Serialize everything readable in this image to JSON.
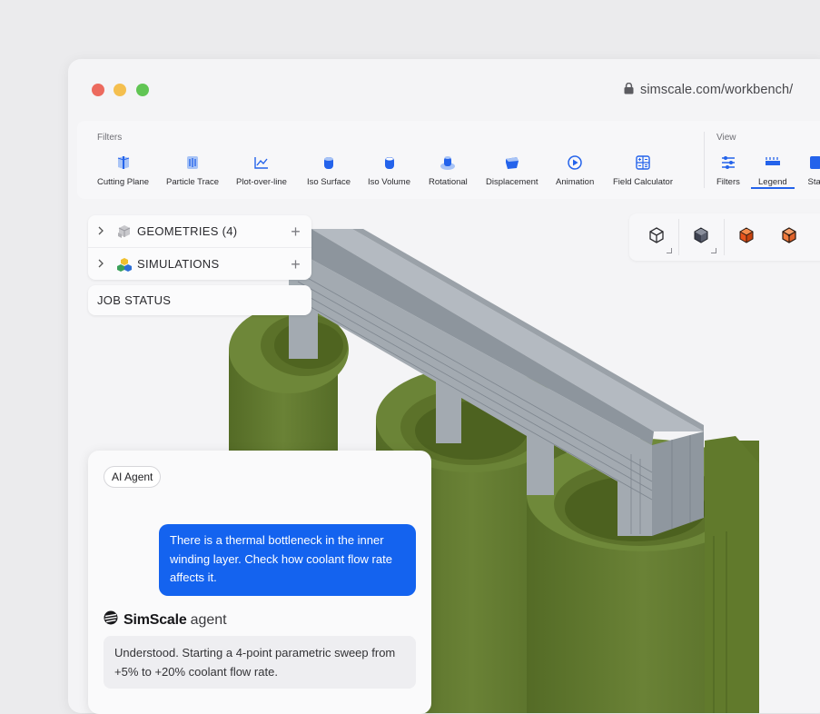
{
  "window": {
    "url": "simscale.com/workbench/"
  },
  "toolbar": {
    "filters_label": "Filters",
    "view_label": "View",
    "filters": [
      {
        "label": "Cutting Plane",
        "icon": "cutting-plane-icon"
      },
      {
        "label": "Particle Trace",
        "icon": "particle-trace-icon"
      },
      {
        "label": "Plot-over-line",
        "icon": "plot-over-line-icon"
      },
      {
        "label": "Iso Surface",
        "icon": "iso-surface-icon"
      },
      {
        "label": "Iso Volume",
        "icon": "iso-volume-icon"
      },
      {
        "label": "Rotational",
        "icon": "rotational-icon"
      },
      {
        "label": "Displacement",
        "icon": "displacement-icon"
      },
      {
        "label": "Animation",
        "icon": "animation-icon"
      },
      {
        "label": "Field Calculator",
        "icon": "field-calculator-icon"
      }
    ],
    "view": [
      {
        "label": "Filters",
        "icon": "filters-sliders-icon"
      },
      {
        "label": "Legend",
        "icon": "legend-icon",
        "active": true
      },
      {
        "label": "Stat",
        "icon": "statistics-icon"
      }
    ],
    "accent_color": "#2463eb"
  },
  "tree": {
    "items": [
      {
        "label": "GEOMETRIES (4)",
        "icon": "geometry-cube-icon"
      },
      {
        "label": "SIMULATIONS",
        "icon": "simulation-cubes-icon"
      }
    ],
    "job_status": "JOB STATUS"
  },
  "viewcubes": [
    {
      "icon": "wireframe-cube-icon"
    },
    {
      "icon": "solid-cube-icon"
    },
    {
      "icon": "orange-solid-cube-icon"
    },
    {
      "icon": "orange-wireframe-cube-icon"
    }
  ],
  "chat": {
    "chip": "AI Agent",
    "user_message": "There is a thermal bottleneck in the inner winding layer. Check how coolant flow rate affects it.",
    "agent_brand_bold": "SimScale",
    "agent_brand_light": "agent",
    "agent_reply": "Understood. Starting a 4-point parametric sweep from +5% to +20% coolant flow rate.",
    "user_bubble_color": "#1463ef"
  },
  "model": {
    "coil_color": "#637a32",
    "core_color": "#a6adb4"
  }
}
